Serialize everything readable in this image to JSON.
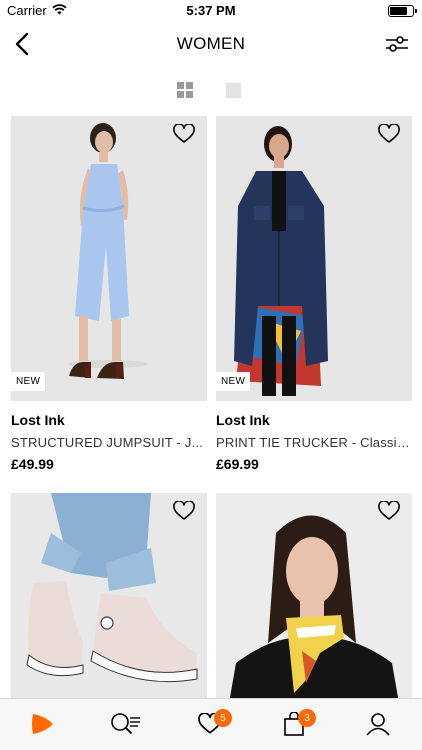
{
  "status": {
    "carrier": "Carrier",
    "time": "5:37 PM",
    "battery_level": 0.75
  },
  "nav": {
    "title": "WOMEN"
  },
  "products": [
    {
      "brand": "Lost Ink",
      "name": "STRUCTURED JUMPSUIT - J...",
      "price": "£49.99",
      "badge": "NEW"
    },
    {
      "brand": "Lost Ink",
      "name": "PRINT TIE TRUCKER - Classic...",
      "price": "£69.99",
      "badge": "NEW"
    },
    {
      "brand": "",
      "name": "",
      "price": "",
      "badge": ""
    },
    {
      "brand": "",
      "name": "",
      "price": "",
      "badge": ""
    }
  ],
  "tabbar": {
    "wishlist_count": "5",
    "bag_count": "3"
  },
  "colors": {
    "accent": "#ff6900"
  }
}
